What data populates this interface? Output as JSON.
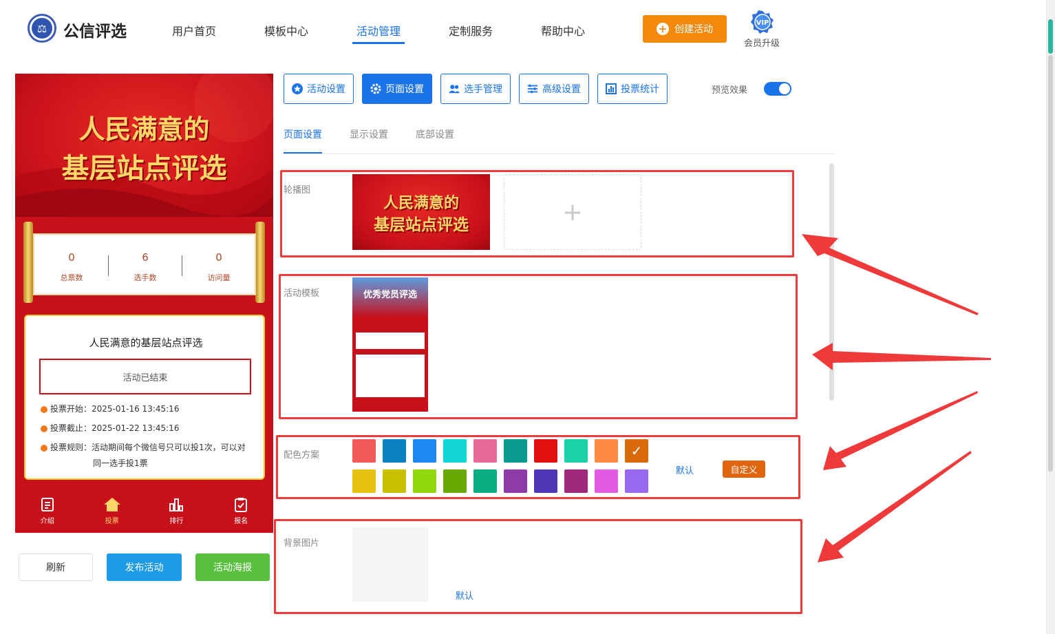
{
  "header": {
    "brand": "公信评选",
    "nav": [
      "用户首页",
      "模板中心",
      "活动管理",
      "定制服务",
      "帮助中心"
    ],
    "active_nav": "活动管理",
    "create_label": "创建活动",
    "vip_text": "VIP",
    "vip_label": "会员升级"
  },
  "preview": {
    "banner_line1": "人民满意的",
    "banner_line2": "基层站点评选",
    "stats": [
      {
        "value": "0",
        "label": "总票数"
      },
      {
        "value": "6",
        "label": "选手数"
      },
      {
        "value": "0",
        "label": "访问量"
      }
    ],
    "activity_title": "人民满意的基层站点评选",
    "status": "活动已结束",
    "vote_start": "投票开始：2025-01-16 13:45:16",
    "vote_end": "投票截止：2025-01-22 13:45:16",
    "rule_line1": "投票规则：活动期间每个微信号只可以投1次，可以对",
    "rule_line2": "同一选手投1票",
    "tabs": [
      "介绍",
      "投票",
      "排行",
      "报名"
    ],
    "active_tab": "投票"
  },
  "bottom_buttons": {
    "refresh": "刷新",
    "publish": "发布活动",
    "poster": "活动海报"
  },
  "toolbar": {
    "buttons": [
      "活动设置",
      "页面设置",
      "选手管理",
      "高级设置",
      "投票统计"
    ],
    "active": "页面设置",
    "preview_label": "预览效果",
    "preview_on": true
  },
  "subtabs": [
    "页面设置",
    "显示设置",
    "底部设置"
  ],
  "sections": {
    "carousel_label": "轮播图",
    "carousel_img_line1": "人民满意的",
    "carousel_img_line2": "基层站点评选",
    "add_symbol": "+",
    "template_label": "活动模板",
    "template_title": "优秀党员评选",
    "color_label": "配色方案",
    "color_default": "默认",
    "color_custom": "自定义",
    "bg_label": "背景图片",
    "bg_default": "默认"
  },
  "colors": {
    "row1": [
      "#f25a5a",
      "#0a82c0",
      "#1e88f0",
      "#12d6d6",
      "#e86a9a",
      "#0b9a8e",
      "#e01010",
      "#1bd1a6",
      "#fd8a45",
      "#d96a0a"
    ],
    "row2": [
      "#e8c010",
      "#c8c000",
      "#92d60c",
      "#68a800",
      "#0bae80",
      "#8e3aa8",
      "#4e36b6",
      "#a0287a",
      "#e45ae0",
      "#9868f0"
    ],
    "selected": "#d96a0a",
    "accent": "#1a73e8",
    "annotation": "#ee3a3a"
  }
}
